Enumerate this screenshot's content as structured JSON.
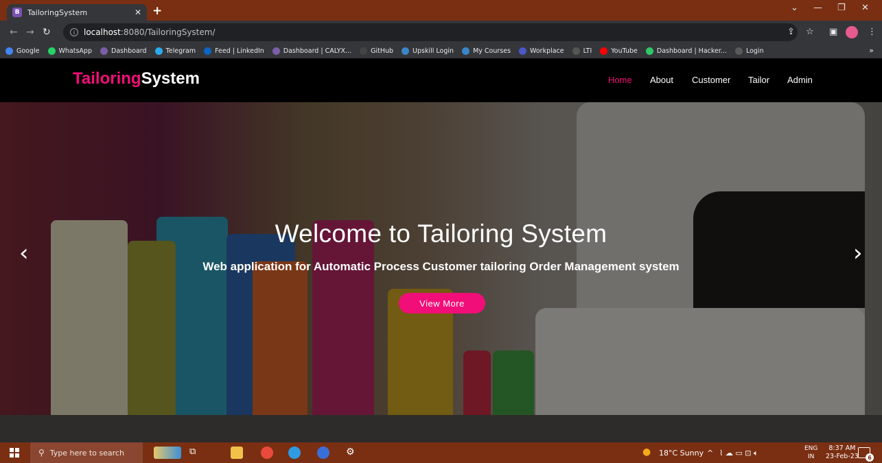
{
  "browser": {
    "tab_title": "TailoringSystem",
    "tab_favicon_letter": "B",
    "new_tab_label": "+",
    "url_host": "localhost",
    "url_path": ":8080/TailoringSystem/",
    "bookmarks": [
      {
        "label": "Google",
        "icon": "google-icon",
        "color": "#4285f4"
      },
      {
        "label": "WhatsApp",
        "icon": "whatsapp-icon",
        "color": "#25d366"
      },
      {
        "label": "Dashboard",
        "icon": "dashboard-icon",
        "color": "#7b5ea7"
      },
      {
        "label": "Telegram",
        "icon": "telegram-icon",
        "color": "#2aabee"
      },
      {
        "label": "Feed | LinkedIn",
        "icon": "linkedin-icon",
        "color": "#0a66c2"
      },
      {
        "label": "Dashboard | CALYX...",
        "icon": "calyx-icon",
        "color": "#7b5ea7"
      },
      {
        "label": "GitHub",
        "icon": "github-icon",
        "color": "#444"
      },
      {
        "label": "Upskill Login",
        "icon": "upskill-icon",
        "color": "#3a86c8"
      },
      {
        "label": "My Courses",
        "icon": "courses-icon",
        "color": "#3a86c8"
      },
      {
        "label": "Workplace",
        "icon": "workplace-icon",
        "color": "#4a58c8"
      },
      {
        "label": "LTI",
        "icon": "lti-icon",
        "color": "#555"
      },
      {
        "label": "YouTube",
        "icon": "youtube-icon",
        "color": "#ff0000"
      },
      {
        "label": "Dashboard | Hacker...",
        "icon": "hackerrank-icon",
        "color": "#2ec866"
      },
      {
        "label": "Login",
        "icon": "login-icon",
        "color": "#5a5a5a"
      }
    ],
    "bookmarks_more": "»"
  },
  "site": {
    "logo_part1": "Tailoring",
    "logo_part2": "System",
    "nav": [
      "Home",
      "About",
      "Customer",
      "Tailor",
      "Admin"
    ],
    "hero_title": "Welcome to Tailoring System",
    "hero_subtitle": "Web application for Automatic Process Customer tailoring Order Management system",
    "hero_button": "View More",
    "prev_arrow": "‹",
    "next_arrow": "›",
    "accent_color": "#f20e78"
  },
  "taskbar": {
    "search_placeholder": "Type here to search",
    "weather": "18°C Sunny",
    "lang_top": "ENG",
    "lang_bottom": "IN",
    "time": "8:37 AM",
    "date": "23-Feb-23",
    "notification_count": "6"
  }
}
